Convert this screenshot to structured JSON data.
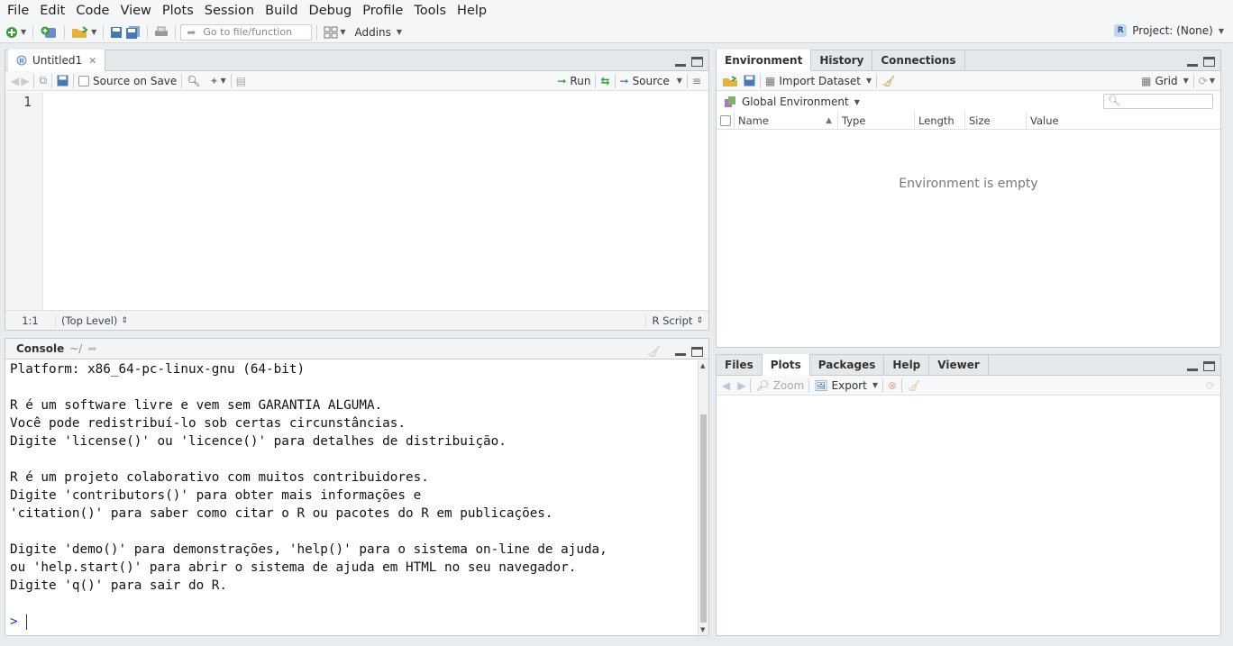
{
  "menu": [
    "File",
    "Edit",
    "Code",
    "View",
    "Plots",
    "Session",
    "Build",
    "Debug",
    "Profile",
    "Tools",
    "Help"
  ],
  "toolbar": {
    "goto_placeholder": "Go to file/function",
    "addins_label": "Addins",
    "project_label": "Project: (None)",
    "project_badge": "R"
  },
  "editor": {
    "tab_label": "Untitled1",
    "source_on_save": "Source on Save",
    "run_label": "Run",
    "source_label": "Source",
    "line_number": "1",
    "cursor_pos": "1:1",
    "scope": "(Top Level)",
    "file_type": "R Script"
  },
  "console": {
    "title": "Console",
    "path": "~/",
    "lines": [
      "Platform: x86_64-pc-linux-gnu (64-bit)",
      "",
      "R é um software livre e vem sem GARANTIA ALGUMA.",
      "Você pode redistribuí-lo sob certas circunstâncias.",
      "Digite 'license()' ou 'licence()' para detalhes de distribuição.",
      "",
      "R é um projeto colaborativo com muitos contribuidores.",
      "Digite 'contributors()' para obter mais informações e",
      "'citation()' para saber como citar o R ou pacotes do R em publicações.",
      "",
      "Digite 'demo()' para demonstrações, 'help()' para o sistema on-line de ajuda,",
      "ou 'help.start()' para abrir o sistema de ajuda em HTML no seu navegador.",
      "Digite 'q()' para sair do R.",
      ""
    ],
    "prompt": ">"
  },
  "environment": {
    "tabs": [
      "Environment",
      "History",
      "Connections"
    ],
    "import_label": "Import Dataset",
    "grid_label": "Grid",
    "scope_label": "Global Environment",
    "columns": [
      "Name",
      "Type",
      "Length",
      "Size",
      "Value"
    ],
    "empty_message": "Environment is empty"
  },
  "files": {
    "tabs": [
      "Files",
      "Plots",
      "Packages",
      "Help",
      "Viewer"
    ],
    "active_tab": "Plots",
    "zoom_label": "Zoom",
    "export_label": "Export"
  },
  "colors": {
    "accent_green": "#3a9b3a",
    "prompt_blue": "#1d3ab5",
    "pane_border": "#c7ccd1"
  }
}
